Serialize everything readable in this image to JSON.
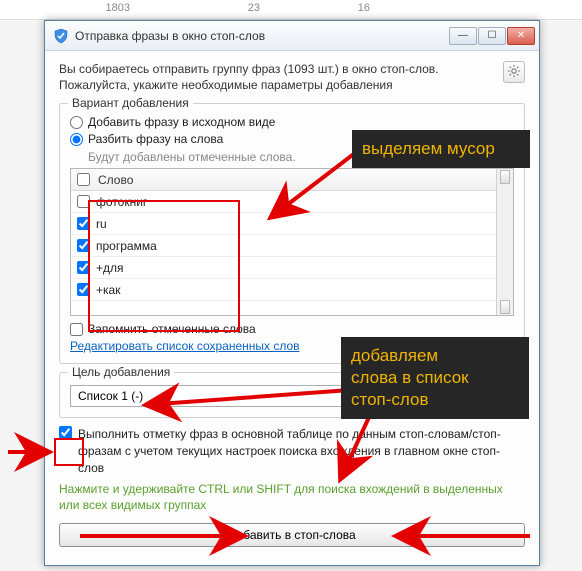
{
  "background_row": {
    "c1": "1803",
    "c2": "23",
    "c3": "16"
  },
  "window": {
    "title": "Отправка фразы в окно стоп-слов",
    "min_glyph": "—",
    "max_glyph": "☐",
    "close_glyph": "✕"
  },
  "intro": {
    "line1": "Вы собираетесь отправить группу фраз (1093 шт.) в окно стоп-слов.",
    "line2": "Пожалуйста, укажите необходимые параметры добавления"
  },
  "variant": {
    "legend": "Вариант добавления",
    "opt1": "Добавить фразу в исходном виде",
    "opt2": "Разбить фразу на слова",
    "hint": "Будут добавлены отмеченные слова.",
    "col_header": "Слово",
    "words": [
      {
        "checked": false,
        "text": "фотокниг"
      },
      {
        "checked": true,
        "text": "ru"
      },
      {
        "checked": true,
        "text": "программа"
      },
      {
        "checked": true,
        "text": "+для"
      },
      {
        "checked": true,
        "text": "+как"
      }
    ],
    "remember": "Запомнить отмеченные слова",
    "edit_link": "Редактировать список сохраненных слов"
  },
  "dest": {
    "legend": "Цель добавления",
    "selected": "Список 1 (-)"
  },
  "mark": {
    "label": "Выполнить отметку фраз в основной таблице по данным стоп-словам/стоп-фразам с учетом текущих настроек поиска вхождения в главном окне стоп-слов",
    "tip": "Нажмите и удерживайте CTRL или SHIFT для поиска вхождений в выделенных или всех видимых группах"
  },
  "main_button": "Добавить в стоп-слова",
  "annotations": {
    "panel1": "выделяем мусор",
    "panel2_l1": "добавляем",
    "panel2_l2": "слова в список",
    "panel2_l3": "стоп-слов"
  }
}
